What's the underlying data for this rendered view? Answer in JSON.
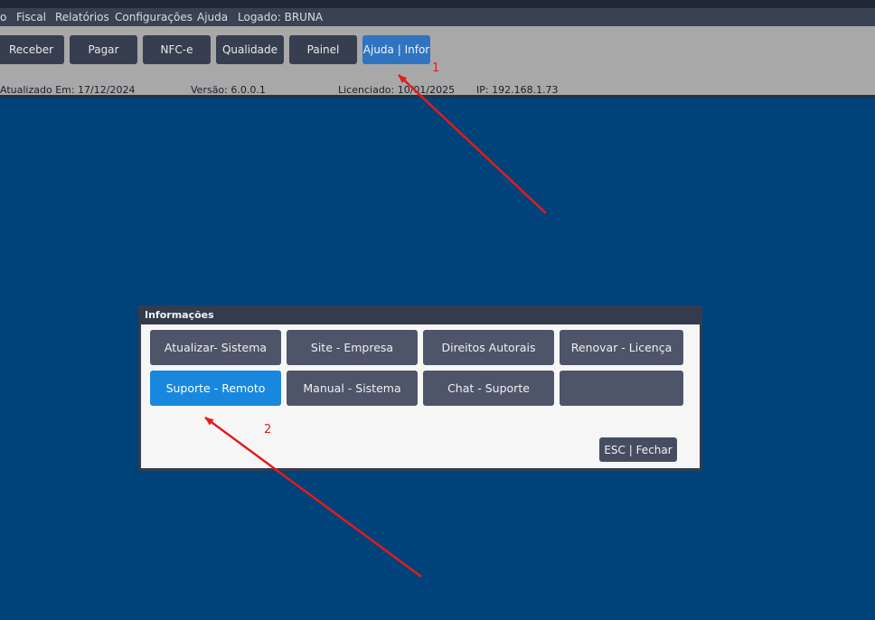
{
  "menubar": {
    "items": [
      "o",
      "Fiscal",
      "Relatórios",
      "Configurações",
      "Ajuda"
    ],
    "logged_user": "Logado: BRUNA"
  },
  "toolbar": {
    "buttons": [
      "Receber",
      "Pagar",
      "NFC-e",
      "Qualidade",
      "Painel",
      "Ajuda | Infor"
    ]
  },
  "status": {
    "updated": "Atualizado Em: 17/12/2024",
    "version": "Versão: 6.0.0.1",
    "licensed": "Licenciado: 10/01/2025",
    "ip": "IP: 192.168.1.73"
  },
  "dialog": {
    "title": "Informações",
    "buttons": [
      "Atualizar- Sistema",
      "Site - Empresa",
      "Direitos Autorais",
      "Renovar - Licença",
      "Suporte - Remoto",
      "Manual - Sistema",
      "Chat - Suporte",
      ""
    ],
    "close_label": "ESC | Fechar"
  },
  "annotations": {
    "marker_1": "1",
    "marker_2": "2",
    "color": "#e31b1b"
  },
  "colors": {
    "desktop_background": "#00427a",
    "active_button": "#1788de"
  }
}
